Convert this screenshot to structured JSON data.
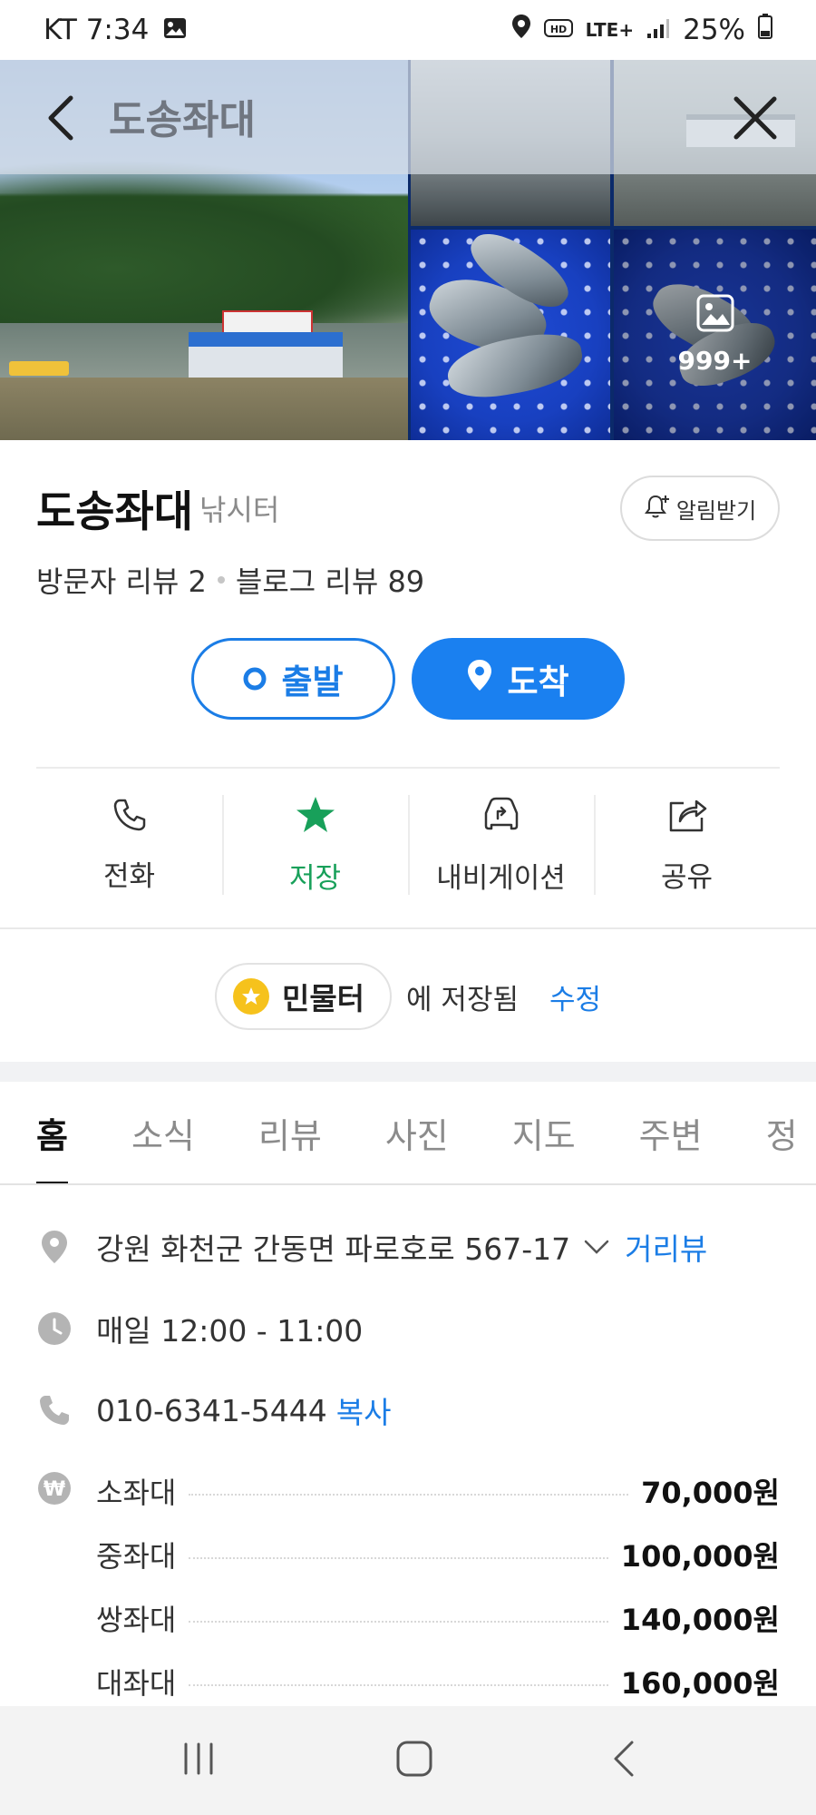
{
  "status_bar": {
    "carrier_time": "KT 7:34",
    "network": "LTE+",
    "battery": "25%"
  },
  "gallery": {
    "more_count": "999+"
  },
  "overlay": {
    "title": "도송좌대"
  },
  "place": {
    "name": "도송좌대",
    "category": "낚시터",
    "alarm_label": "알림받기",
    "visitor_reviews": "방문자 리뷰 2",
    "blog_reviews": "블로그 리뷰 89"
  },
  "route": {
    "depart_label": "출발",
    "arrive_label": "도착"
  },
  "actions": [
    {
      "label": "전화",
      "icon": "phone-icon"
    },
    {
      "label": "저장",
      "icon": "star-icon"
    },
    {
      "label": "내비게이션",
      "icon": "car-navigation-icon"
    },
    {
      "label": "공유",
      "icon": "share-icon"
    }
  ],
  "saved": {
    "folder": "민물터",
    "suffix": "에 저장됨",
    "edit": "수정"
  },
  "tabs": [
    "홈",
    "소식",
    "리뷰",
    "사진",
    "지도",
    "주변",
    "정"
  ],
  "details": {
    "address": "강원 화천군 간동면 파로호로 567-17",
    "street_view": "거리뷰",
    "hours": "매일 12:00 - 11:00",
    "phone": "010-6341-5444",
    "copy": "복사"
  },
  "prices": [
    {
      "name": "소좌대",
      "price": "70,000원"
    },
    {
      "name": "중좌대",
      "price": "100,000원"
    },
    {
      "name": "쌍좌대",
      "price": "140,000원"
    },
    {
      "name": "대좌대",
      "price": "160,000원"
    }
  ],
  "colors": {
    "accent": "#1a80f0",
    "saved_green": "#18a05a",
    "badge_yellow": "#f6c21c"
  }
}
